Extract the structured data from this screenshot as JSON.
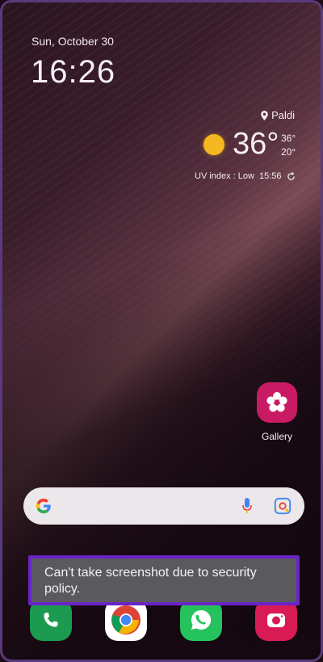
{
  "lockscreen": {
    "date": "Sun, October 30",
    "time": "16:26"
  },
  "weather": {
    "location": "Paldi",
    "temperature": "36°",
    "high": "36°",
    "low": "20°",
    "uv_text": "UV index : Low",
    "updated_time": "15:56",
    "sun_color": "#f4b820"
  },
  "apps": {
    "gallery_label": "Gallery",
    "gallery_color": "#c81b63"
  },
  "search": {
    "brand": "Google"
  },
  "toast": {
    "message": "Can't take screenshot due to security policy."
  },
  "dock": {
    "icons": [
      "phone-icon",
      "chrome-icon",
      "whatsapp-icon",
      "camera-icon"
    ]
  }
}
